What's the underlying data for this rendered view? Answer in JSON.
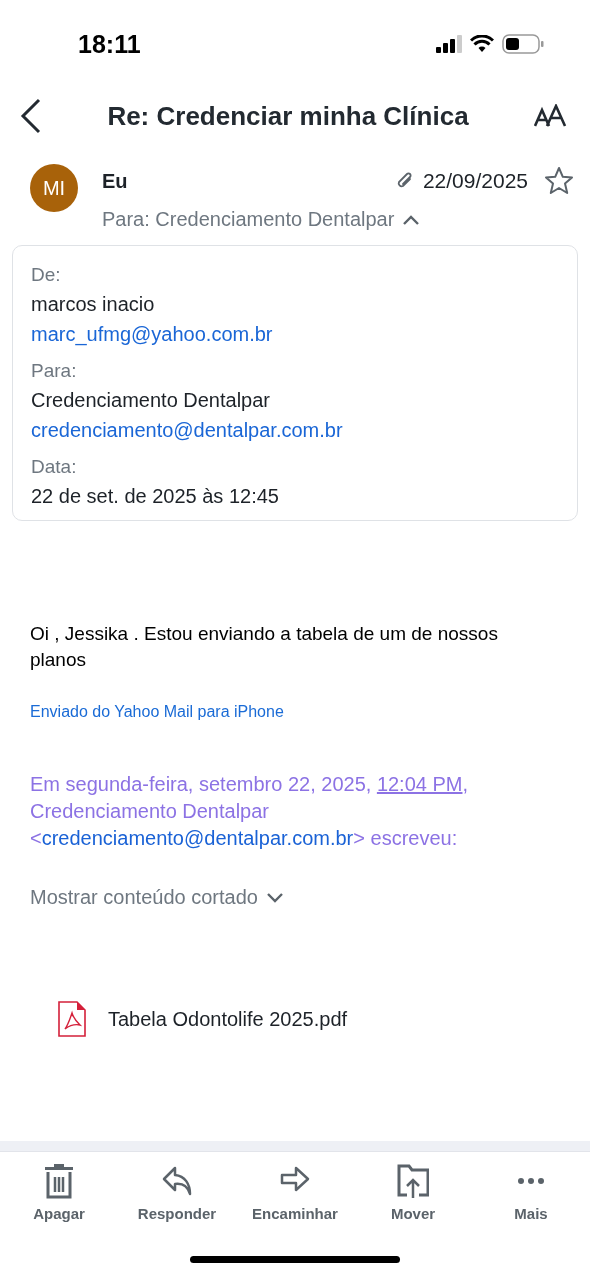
{
  "status_bar": {
    "time": "18:11"
  },
  "header": {
    "title": "Re: Credenciar minha Clínica"
  },
  "message": {
    "avatar_initials": "MI",
    "sender": "Eu",
    "date": "22/09/2025",
    "starred": false,
    "recipients": "Para: Credenciamento Dentalpar",
    "expanded": true
  },
  "details": [
    {
      "label": "De:",
      "lines": [
        {
          "text": "marcos inacio",
          "kind": "name"
        },
        {
          "text": "marc_ufmg@yahoo.com.br",
          "kind": "email"
        }
      ]
    },
    {
      "label": "Para:",
      "lines": [
        {
          "text": "Credenciamento Dentalpar",
          "kind": "name"
        },
        {
          "text": "credenciamento@dentalpar.com.br",
          "kind": "email"
        }
      ]
    },
    {
      "label": "Data:",
      "lines": [
        {
          "text": "22 de set. de 2025 às 12:45",
          "kind": "name"
        }
      ]
    }
  ],
  "body": {
    "text": "Oi , Jessika . Estou enviando a tabela de um de nossos planos",
    "signature": "Enviado do Yahoo Mail para iPhone",
    "quote_lines": [
      [
        {
          "text": "Em segunda-feira, setembro 22, 2025, ",
          "kind": "text"
        },
        {
          "text": "12:04 PM",
          "kind": "time-link"
        },
        {
          "text": ",",
          "kind": "text"
        }
      ],
      [
        {
          "text": "Credenciamento Dentalpar",
          "kind": "text"
        }
      ],
      [
        {
          "text": "<",
          "kind": "text"
        },
        {
          "text": "credenciamento@dentalpar.com.br",
          "kind": "email-link"
        },
        {
          "text": "> escreveu:",
          "kind": "text"
        }
      ]
    ],
    "show_more": "Mostrar conteúdo cortado"
  },
  "attachments": [
    {
      "name": "Tabela Odontolife 2025.pdf"
    }
  ],
  "toolbar": [
    {
      "label": "Apagar",
      "kind": "delete"
    },
    {
      "label": "Responder",
      "kind": "reply"
    },
    {
      "label": "Encaminhar",
      "kind": "forward"
    },
    {
      "label": "Mover",
      "kind": "move"
    },
    {
      "label": "Mais",
      "kind": "more"
    }
  ]
}
